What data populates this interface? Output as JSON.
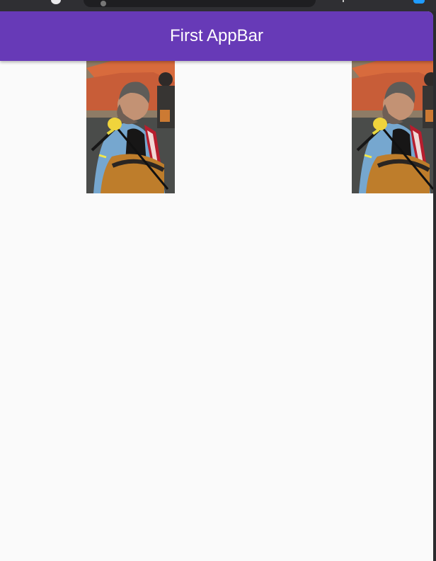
{
  "app_bar": {
    "title": "First AppBar",
    "color": "#673ab7"
  },
  "photos": [
    {
      "subject": "musician-singing-into-microphone"
    },
    {
      "subject": "musician-singing-into-microphone"
    }
  ],
  "colors": {
    "window_background": "#fafafa",
    "app_bar_text": "#ffffff",
    "browser_frame": "#2f2f33"
  }
}
